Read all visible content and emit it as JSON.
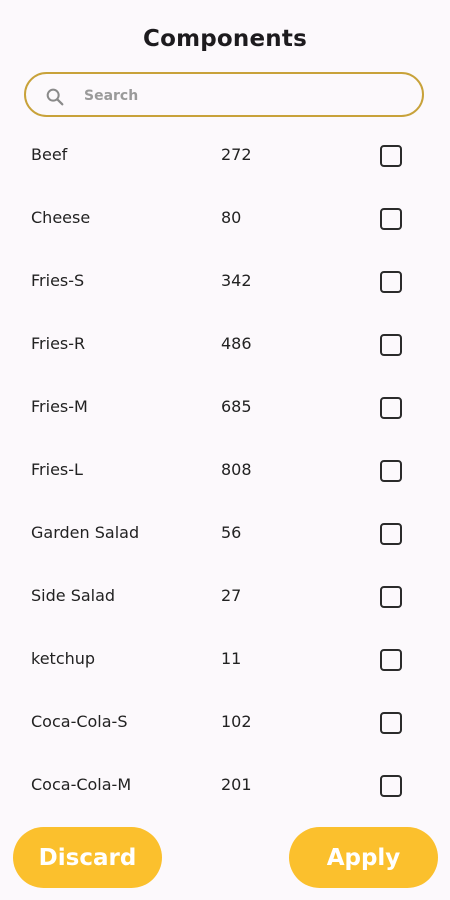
{
  "header": {
    "title": "Components"
  },
  "search": {
    "placeholder": "Search",
    "value": ""
  },
  "items": [
    {
      "name": "Beef",
      "qty": "272",
      "checked": false
    },
    {
      "name": "Cheese",
      "qty": "80",
      "checked": false
    },
    {
      "name": "Fries-S",
      "qty": "342",
      "checked": false
    },
    {
      "name": "Fries-R",
      "qty": "486",
      "checked": false
    },
    {
      "name": "Fries-M",
      "qty": "685",
      "checked": false
    },
    {
      "name": "Fries-L",
      "qty": "808",
      "checked": false
    },
    {
      "name": "Garden Salad",
      "qty": "56",
      "checked": false
    },
    {
      "name": "Side Salad",
      "qty": "27",
      "checked": false
    },
    {
      "name": "ketchup",
      "qty": "11",
      "checked": false
    },
    {
      "name": "Coca-Cola-S",
      "qty": "102",
      "checked": false
    },
    {
      "name": "Coca-Cola-M",
      "qty": "201",
      "checked": false
    }
  ],
  "actions": {
    "discard_label": "Discard",
    "apply_label": "Apply"
  },
  "colors": {
    "accent": "#fbc02d",
    "search_border": "#c8a23a",
    "background": "#fcf9fc"
  },
  "icons": {
    "search": "search-icon",
    "checkbox": "checkbox-unchecked"
  }
}
